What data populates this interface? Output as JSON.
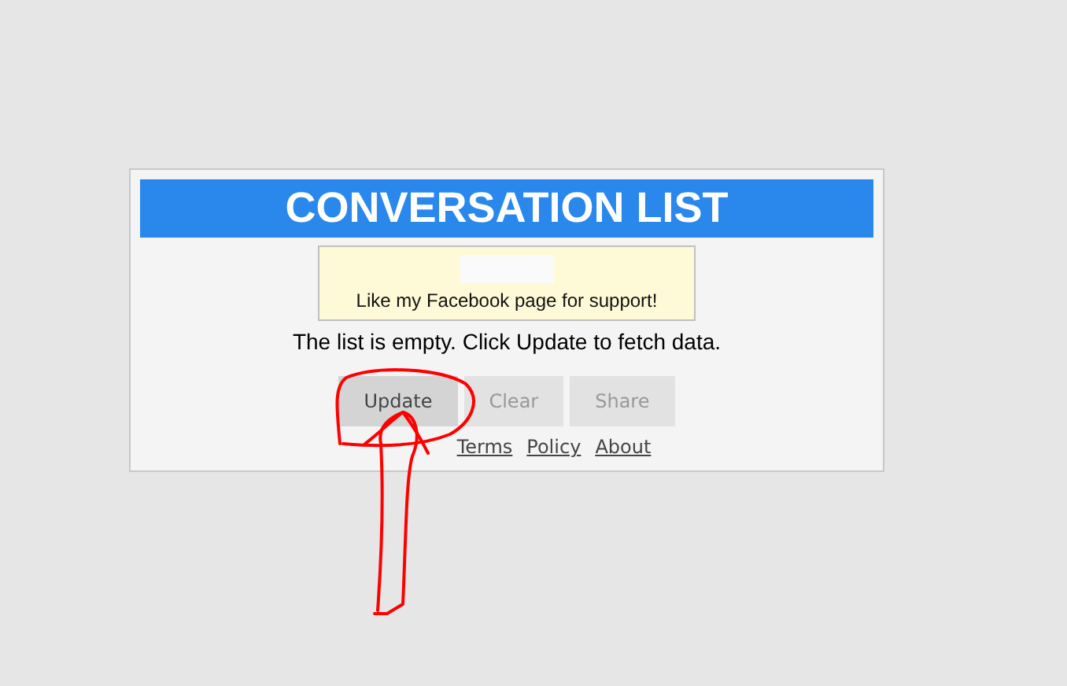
{
  "header": {
    "title": "CONVERSATION LIST"
  },
  "notice": {
    "text": "Like my Facebook page for support!"
  },
  "message": "The list is empty. Click Update to fetch data.",
  "buttons": [
    {
      "label": "Update",
      "disabled": false
    },
    {
      "label": "Clear",
      "disabled": true
    },
    {
      "label": "Share",
      "disabled": true
    }
  ],
  "links": [
    "Terms",
    "Policy",
    "About"
  ]
}
